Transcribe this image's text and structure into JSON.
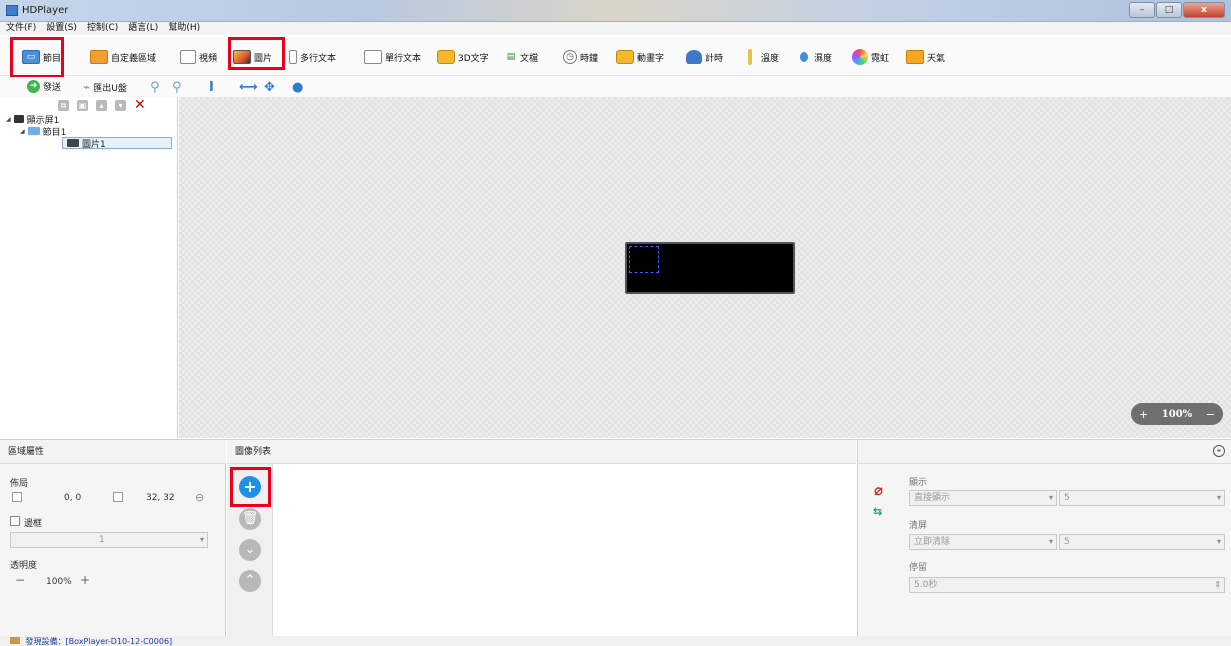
{
  "window": {
    "title": "HDPlayer",
    "controls": [
      "–",
      "□",
      "x"
    ]
  },
  "menu": [
    "文件(F)",
    "設置(S)",
    "控制(C)",
    "語言(L)",
    "幫助(H)"
  ],
  "toolbar1": [
    {
      "label": "節目",
      "icon": "program-icon"
    },
    {
      "label": "自定義區域",
      "icon": "custom-area-icon"
    },
    {
      "label": "視頻",
      "icon": "video-icon"
    },
    {
      "label": "圖片",
      "icon": "picture-icon"
    },
    {
      "label": "多行文本",
      "icon": "multiline-text-icon"
    },
    {
      "label": "單行文本",
      "icon": "single-line-text-icon"
    },
    {
      "label": "3D文字",
      "icon": "3d-text-icon"
    },
    {
      "label": "文檔",
      "icon": "document-icon"
    },
    {
      "label": "時鐘",
      "icon": "clock-icon"
    },
    {
      "label": "動畫字",
      "icon": "animated-text-icon"
    },
    {
      "label": "計時",
      "icon": "timer-icon"
    },
    {
      "label": "溫度",
      "icon": "thermometer-icon"
    },
    {
      "label": "濕度",
      "icon": "humidity-icon"
    },
    {
      "label": "霓虹",
      "icon": "neon-icon"
    },
    {
      "label": "天氣",
      "icon": "weather-icon"
    }
  ],
  "toolbar2": {
    "send_label": "發送",
    "export_label": "匯出U盤"
  },
  "tree": {
    "screen": "顯示屏1",
    "program": "節目1",
    "picture": "圖片1"
  },
  "canvas": {
    "zoom": "100%",
    "zoom_in": "+",
    "zoom_out": "−"
  },
  "props": {
    "header": "區域屬性",
    "layout_label": "佈局",
    "position": "0, 0",
    "size": "32, 32",
    "border_label": "邊框",
    "border_value": "1",
    "opacity_label": "透明度",
    "opacity_value": "100%",
    "minus": "−",
    "plus": "+"
  },
  "image_list": {
    "header": "圖像列表"
  },
  "effects": {
    "display_label": "顯示",
    "display_value": "直接顯示",
    "display_speed": "5",
    "clear_label": "清屏",
    "clear_value": "立即清除",
    "clear_speed": "5",
    "stay_label": "停留",
    "stay_value": "5.0秒"
  },
  "status": {
    "text": "發現設備：[BoxPlayer-D10-12-C0006]"
  },
  "colors": {
    "highlight": "#e8001c",
    "accent": "#1e90e8",
    "screen": "#000000"
  }
}
